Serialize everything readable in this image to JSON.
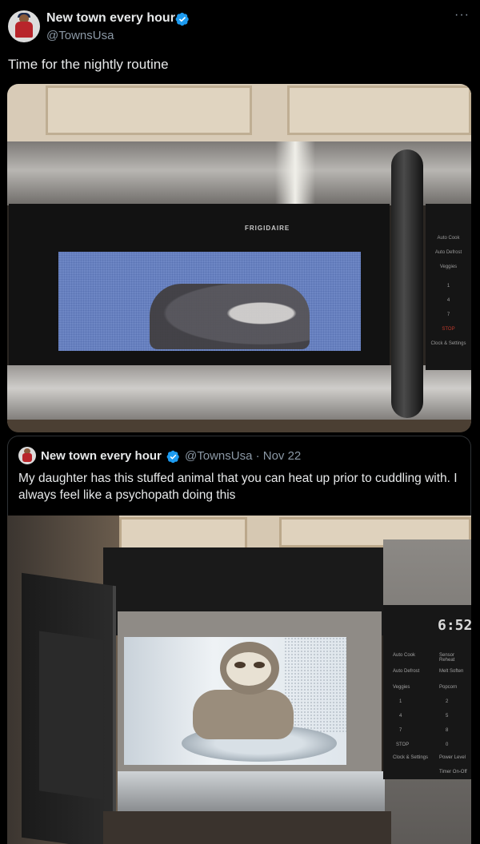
{
  "tweet": {
    "display_name": "New town every hour",
    "handle": "@TownsUsa",
    "text": "Time for the nightly routine",
    "more_label": "···"
  },
  "photo1": {
    "brand": "FRIGIDAIRE",
    "panel_labels": [
      "Auto Cook",
      "Auto Defrost",
      "Veggies",
      "1",
      "4",
      "7",
      "STOP",
      "Clock & Settings"
    ]
  },
  "quoted": {
    "display_name": "New town every hour",
    "meta": "@TownsUsa · Nov 22",
    "text": "My daughter has this stuffed animal that you can heat up prior to cuddling with. I always feel like a psychopath doing this"
  },
  "photo2": {
    "clock": "6:52",
    "panel_labels": [
      "Auto Cook",
      "Sensor Reheat",
      "Auto Defrost",
      "Melt Soften",
      "Veggies",
      "Popcorn",
      "1",
      "2",
      "4",
      "5",
      "7",
      "8",
      "STOP",
      "0",
      "Clock & Settings",
      "Power Level",
      "Timer On-Off"
    ]
  },
  "colors": {
    "background": "#000000",
    "text": "#e7e9ea",
    "secondary_text": "#8b98a5",
    "verified": "#1d9bf0",
    "border": "#2f3336"
  },
  "icons": [
    "verified-badge-icon",
    "more-options-icon"
  ]
}
